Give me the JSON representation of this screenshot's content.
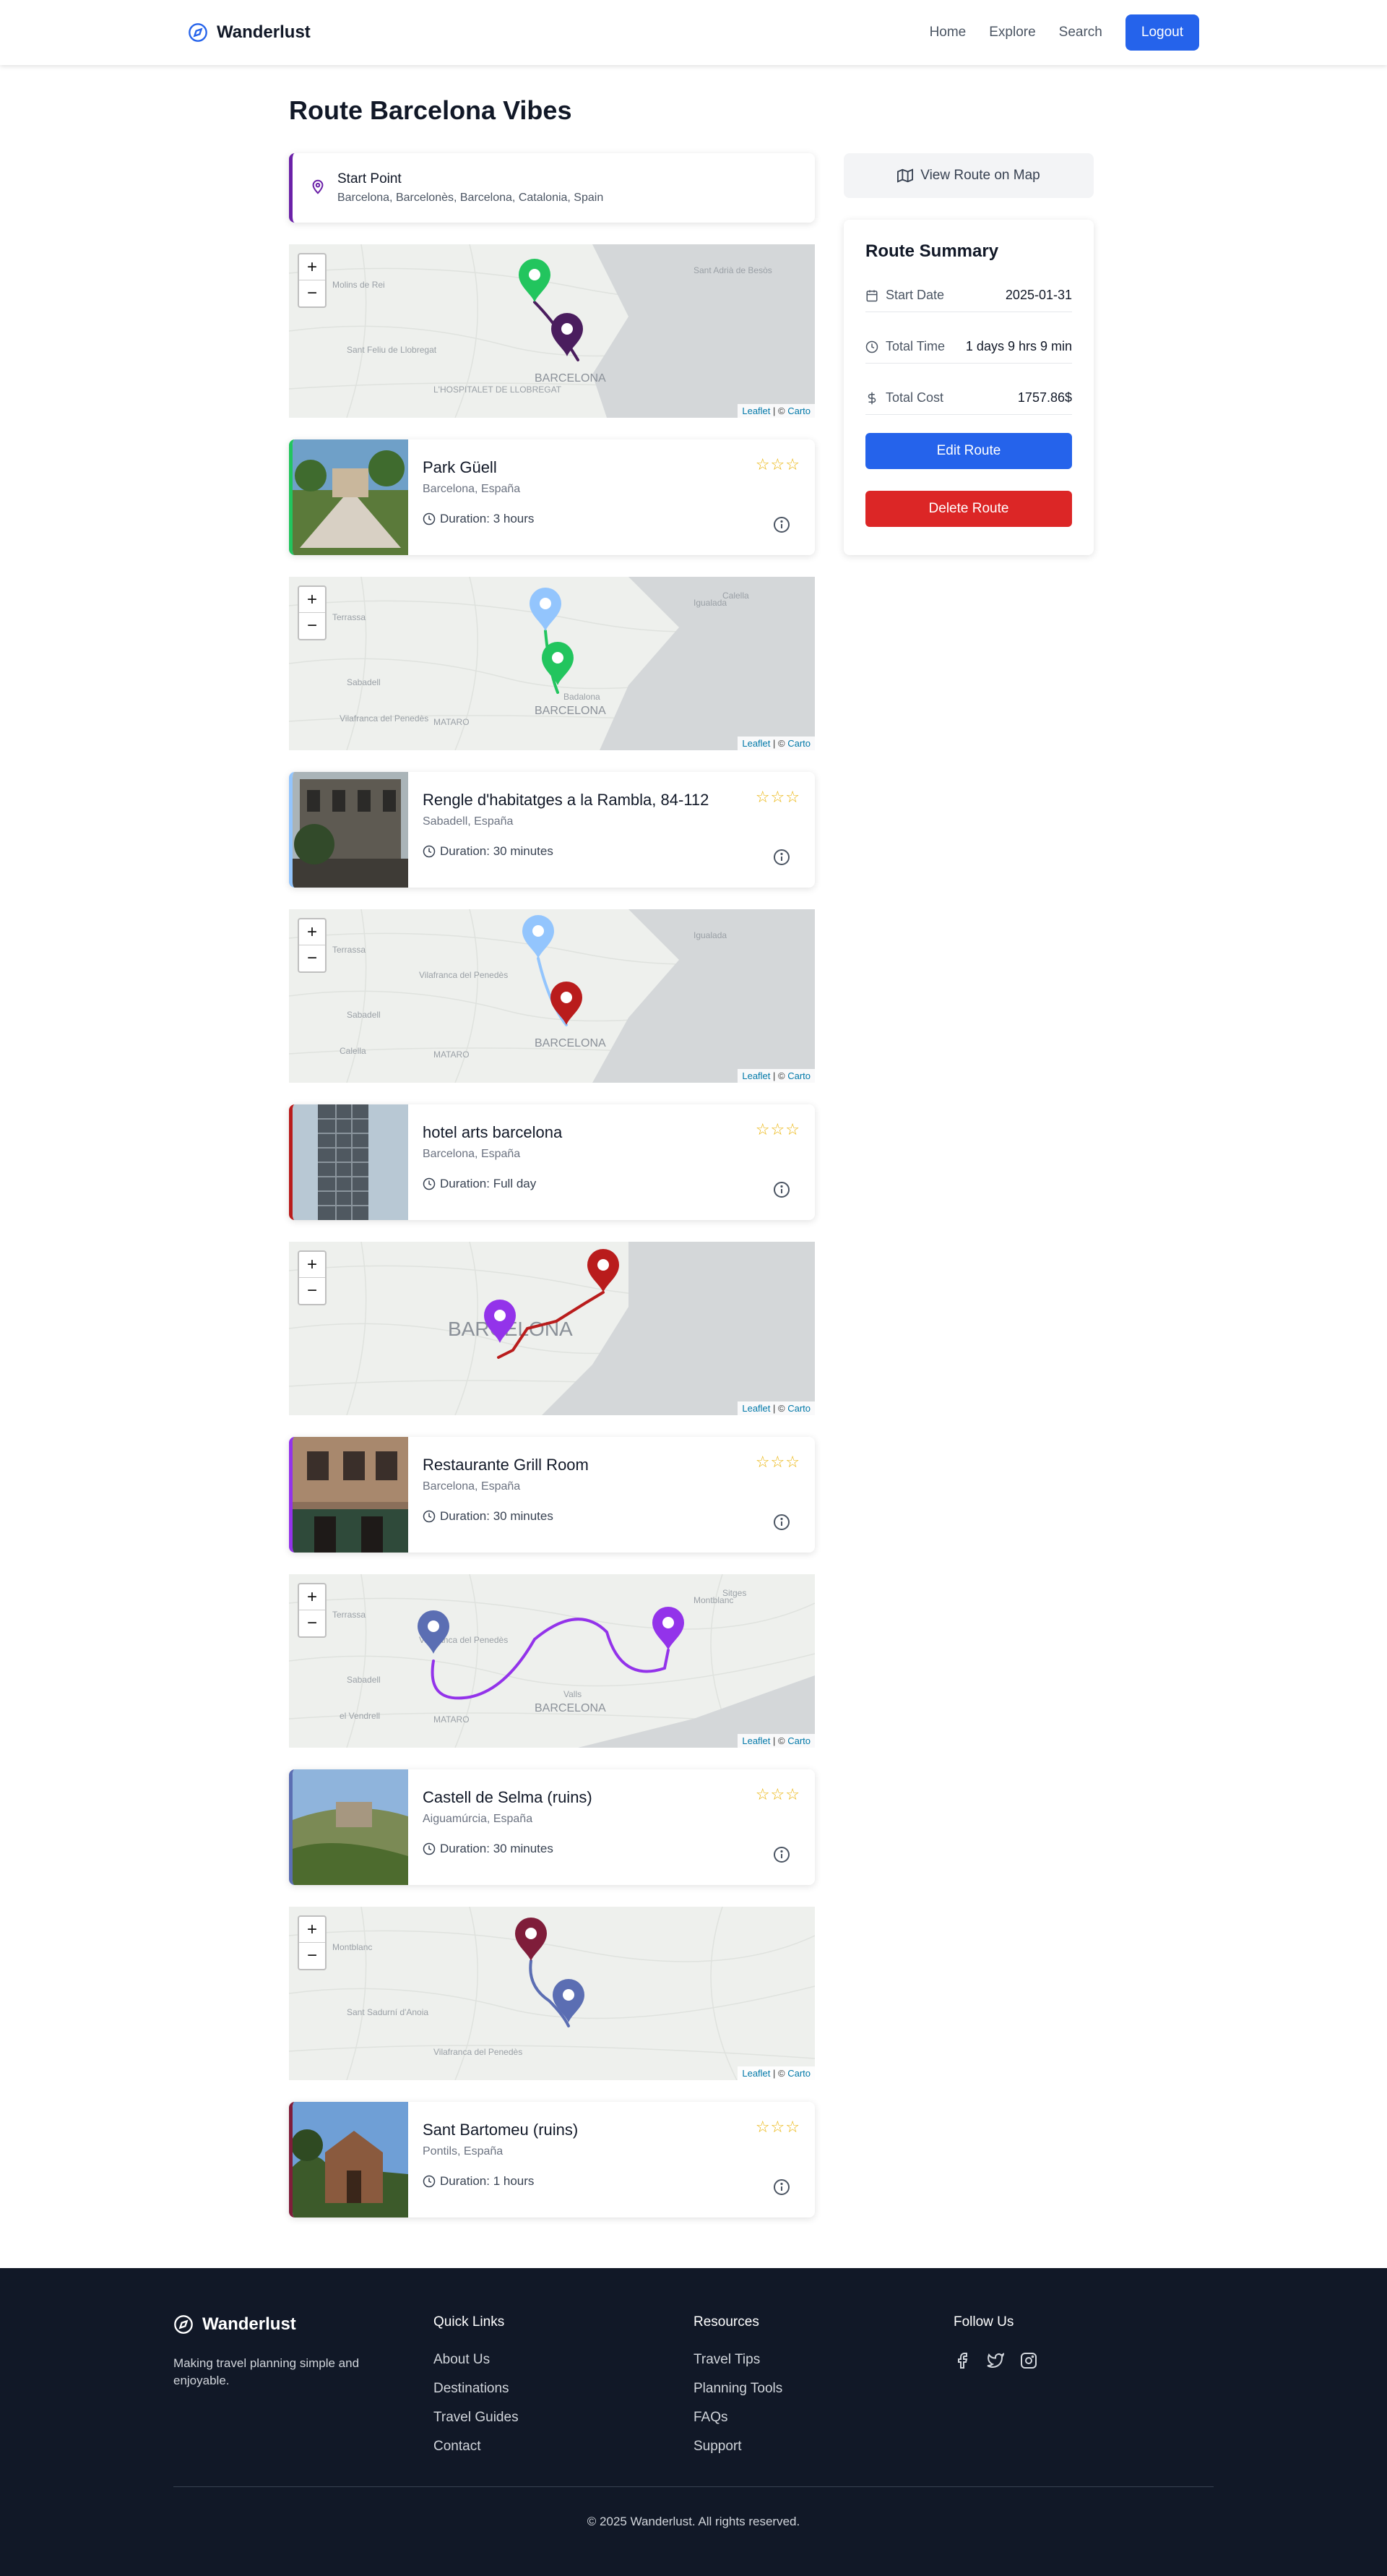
{
  "nav": {
    "brand": "Wanderlust",
    "links": [
      "Home",
      "Explore",
      "Search"
    ],
    "logout": "Logout"
  },
  "page": {
    "title": "Route Barcelona Vibes"
  },
  "start": {
    "title": "Start Point",
    "address": "Barcelona, Barcelonès, Barcelona, Catalonia, Spain"
  },
  "map": {
    "zoom_in": "+",
    "zoom_out": "−",
    "attrib_leaflet": "Leaflet",
    "attrib_sep": " | © ",
    "attrib_carto": "Carto"
  },
  "stops": [
    {
      "name": "Park Güell",
      "location": "Barcelona, España",
      "duration": "Duration: 3 hours",
      "stars": "☆☆☆",
      "accent": "#22c55e"
    },
    {
      "name": "Rengle d'habitatges a la Rambla, 84-112",
      "location": "Sabadell, España",
      "duration": "Duration: 30 minutes",
      "stars": "☆☆☆",
      "accent": "#93c5fd"
    },
    {
      "name": "hotel arts barcelona",
      "location": "Barcelona, España",
      "duration": "Duration: Full day",
      "stars": "☆☆☆",
      "accent": "#b91c1c"
    },
    {
      "name": "Restaurante Grill Room",
      "location": "Barcelona, España",
      "duration": "Duration: 30 minutes",
      "stars": "☆☆☆",
      "accent": "#9333ea"
    },
    {
      "name": "Castell de Selma (ruins)",
      "location": "Aiguamúrcia, España",
      "duration": "Duration: 30 minutes",
      "stars": "☆☆☆",
      "accent": "#5b6eb3"
    },
    {
      "name": "Sant Bartomeu (ruins)",
      "location": "Pontils, España",
      "duration": "Duration: 1 hours",
      "stars": "☆☆☆",
      "accent": "#7f1d3a"
    }
  ],
  "maps": [
    {
      "labels": [
        "Molins de Rei",
        "Sant Feliu de Llobregat",
        "L'HOSPITALET DE LLOBREGAT",
        "Sant Adrià de Besòs",
        "BARCELONA"
      ]
    },
    {
      "labels": [
        "Terrassa",
        "Sabadell",
        "MATARO",
        "Igualada",
        "Badalona",
        "BARCELONA",
        "Vilafranca del Penedès",
        "Calella"
      ]
    },
    {
      "labels": [
        "Terrassa",
        "Sabadell",
        "MATARO",
        "Igualada",
        "BARCELONA",
        "Vilafranca del Penedès",
        "Calella"
      ]
    },
    {
      "labels": [
        "BARCELONA"
      ]
    },
    {
      "labels": [
        "Terrassa",
        "Sabadell",
        "MATARO",
        "Montblanc",
        "Valls",
        "Vilafranca del Penedès",
        "el Vendrell",
        "Sitges",
        "BARCELONA"
      ]
    },
    {
      "labels": [
        "Montblanc",
        "Sant Sadurní d'Anoia",
        "Vilafranca del Penedès"
      ]
    }
  ],
  "sidebar": {
    "view_map": "View Route on Map",
    "summary_title": "Route Summary",
    "start_date_label": "Start Date",
    "start_date": "2025-01-31",
    "total_time_label": "Total Time",
    "total_time": "1 days 9 hrs 9 min",
    "total_cost_label": "Total Cost",
    "total_cost": "1757.86$",
    "edit": "Edit Route",
    "delete": "Delete Route"
  },
  "footer": {
    "brand": "Wanderlust",
    "tagline": "Making travel planning simple and enjoyable.",
    "quick_title": "Quick Links",
    "quick": [
      "About Us",
      "Destinations",
      "Travel Guides",
      "Contact"
    ],
    "res_title": "Resources",
    "resources": [
      "Travel Tips",
      "Planning Tools",
      "FAQs",
      "Support"
    ],
    "follow_title": "Follow Us",
    "copyright": "© 2025 Wanderlust. All rights reserved."
  },
  "colors": {
    "primary": "#2563eb",
    "danger": "#dc2626",
    "footer_bg": "#111827"
  }
}
